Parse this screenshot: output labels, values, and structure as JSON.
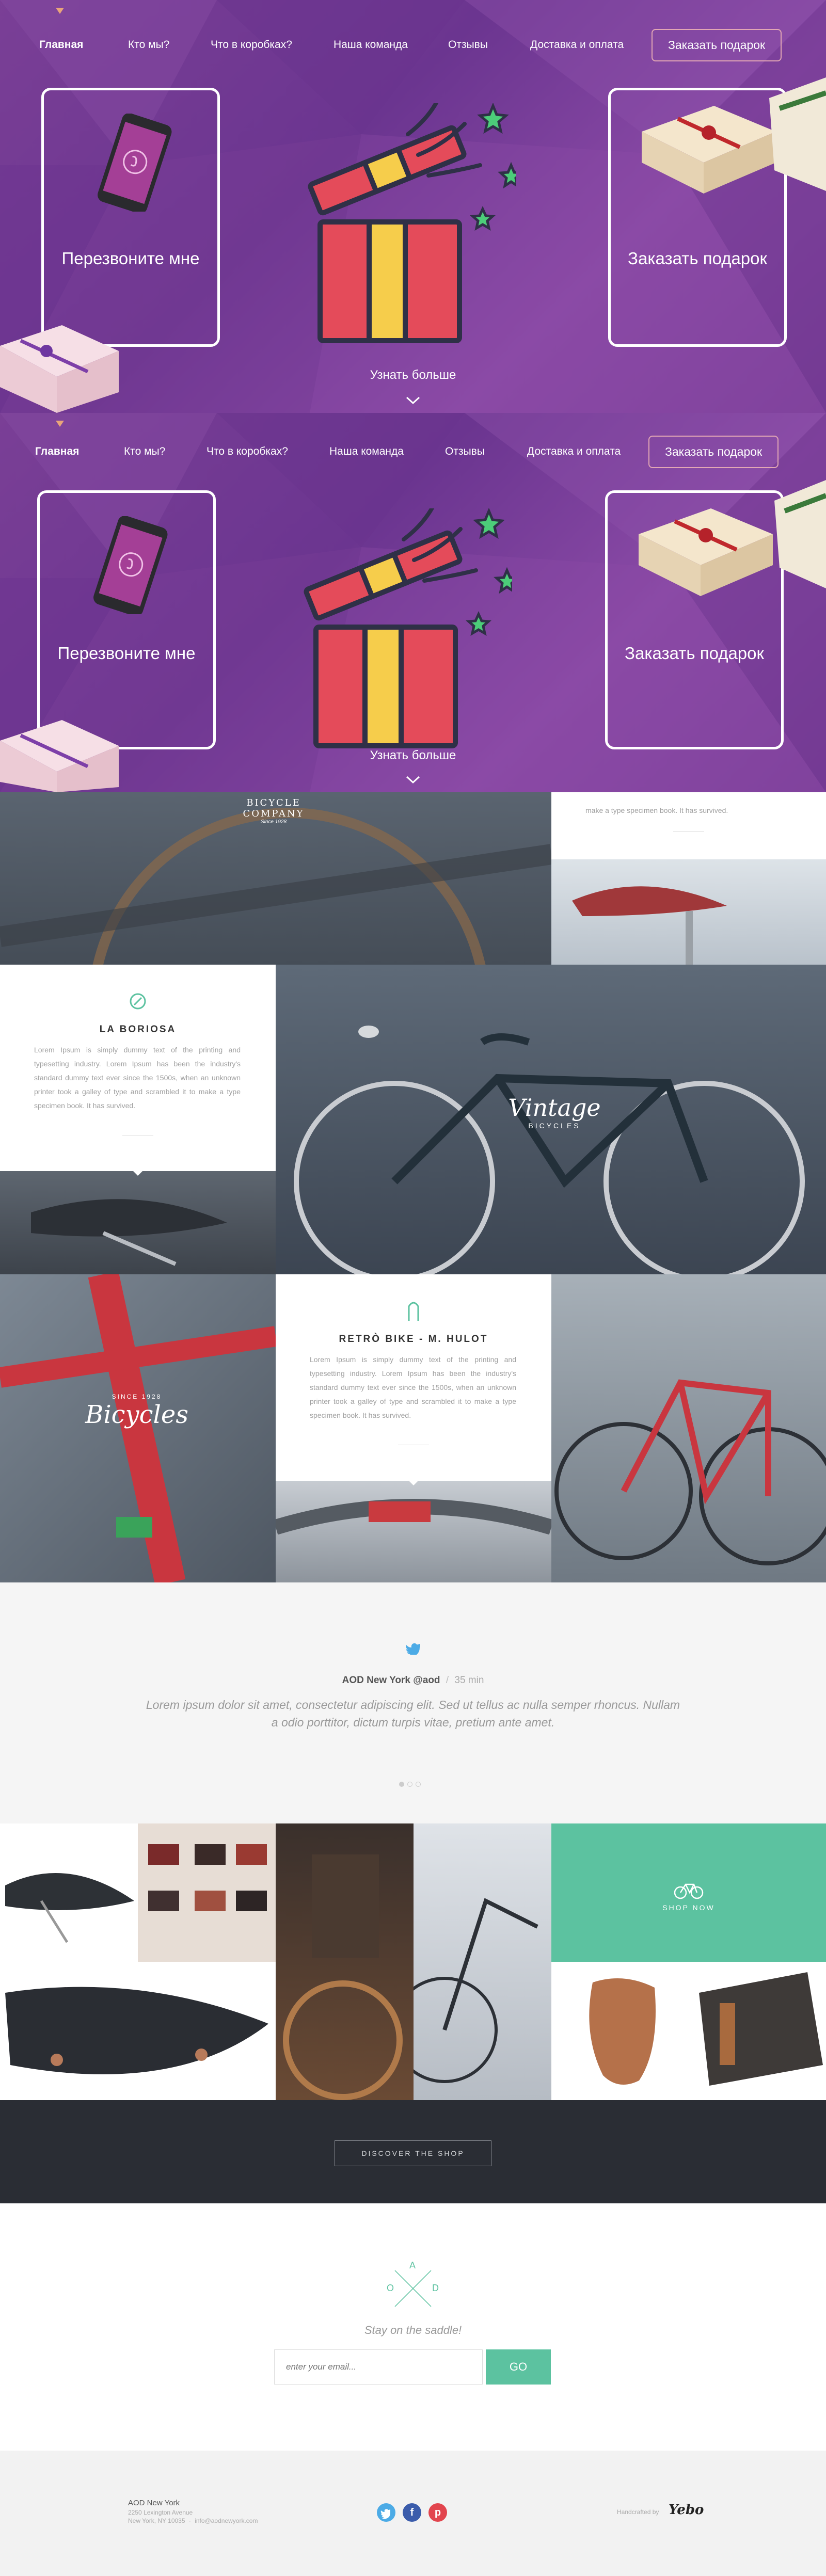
{
  "nav": {
    "items": [
      "Главная",
      "Кто мы?",
      "Что в коробках?",
      "Наша команда",
      "Отзывы",
      "Доставка и оплата"
    ],
    "order_button": "Заказать подарок"
  },
  "hero": {
    "call_label": "Перезвоните мне",
    "order_label": "Заказать подарок",
    "more_label": "Узнать больше"
  },
  "hero2": {
    "call_label": "Перезвоните мне",
    "order_label": "Заказать подарок",
    "more_label": "Узнать больше"
  },
  "gallery": {
    "bicycle_logo": [
      "BICYCLE",
      "COMPANY",
      "Since 1928"
    ],
    "survived_text": "make a type specimen book. It has survived.",
    "boriosa": {
      "title": "LA BORIOSA",
      "text": "Lorem Ipsum is simply dummy text of the printing and typesetting industry. Lorem Ipsum has been the industry's standard dummy text ever since the 1500s, when an unknown printer took a galley of type and scrambled it to make a type specimen book. It has survived."
    },
    "vintage": [
      "Vintage",
      "BICYCLES"
    ],
    "retro": {
      "title": "RETRÒ BIKE - M. HULOT",
      "text": "Lorem Ipsum is simply dummy text of the printing and typesetting industry. Lorem Ipsum has been the industry's standard dummy text ever since the 1500s, when an unknown printer took a galley of type and scrambled it to make a type specimen book. It has survived."
    },
    "bicycles": [
      "SINCE 1928",
      "Bicycles"
    ]
  },
  "tweet": {
    "author": "AOD New York",
    "handle": "@aod",
    "time": "35 min",
    "text": "Lorem ipsum dolor sit amet, consectetur adipiscing elit. Sed ut tellus ac nulla semper rhoncus. Nullam a odio porttitor, dictum turpis vitae, pretium ante amet."
  },
  "shop": {
    "shop_now": "SHOP NOW",
    "discover": "DISCOVER THE SHOP"
  },
  "newsletter": {
    "logo": [
      "A",
      "O",
      "D"
    ],
    "tagline": "Stay on the saddle!",
    "placeholder": "enter your email...",
    "go": "GO"
  },
  "footer": {
    "name": "AOD New York",
    "address": "2250 Lexington Avenue",
    "city": "New York, NY 10035",
    "email": "info@aodnewyork.com",
    "credit": "Handcrafted by",
    "brand": "Yebo"
  },
  "colors": {
    "purple": "#7a3f96",
    "accent_green": "#5cc2a0",
    "dark": "#2a2d34",
    "twitter": "#4cabe6"
  }
}
